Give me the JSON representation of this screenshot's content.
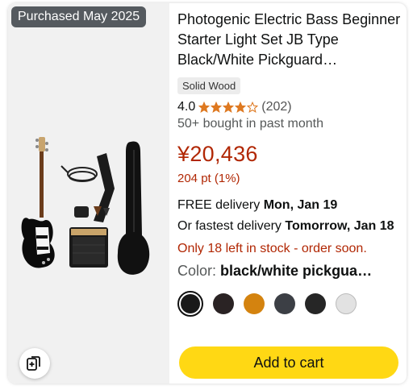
{
  "badge": {
    "purchased": "Purchased May 2025"
  },
  "product": {
    "title": "Photogenic Electric Bass Beginner Starter Light Set JB Type Black/White Pickguard…",
    "material": "Solid Wood",
    "rating": "4.0",
    "rating_stars": 4,
    "rating_count": "(202)",
    "bought": "50+ bought in past month",
    "price": "¥20,436",
    "points": "204 pt (1%)"
  },
  "delivery": {
    "free_prefix": "FREE delivery ",
    "free_date": "Mon, Jan 19",
    "fastest_prefix": "Or fastest delivery ",
    "fastest_date": "Tomorrow, Jan 18"
  },
  "stock": "Only 18 left in stock - order soon.",
  "color": {
    "label": "Color: ",
    "value": "black/white pickgua…",
    "swatches": [
      "#1a1a1a",
      "#2a2324",
      "#d4830f",
      "#3c3f45",
      "#262626",
      "#e2e2e2"
    ]
  },
  "cart": {
    "label": "Add to cart"
  },
  "colors": {
    "price": "#b12704",
    "cart": "#ffd814",
    "star": "#de7921"
  },
  "icons": {
    "compare": "compare-icon"
  }
}
